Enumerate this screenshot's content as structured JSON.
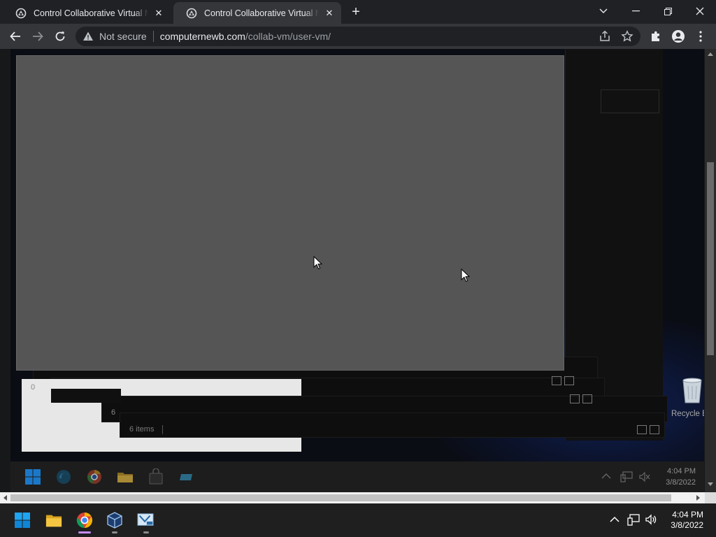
{
  "browser": {
    "tabs": [
      {
        "title": "Control Collaborative Virtual Machines",
        "active": false
      },
      {
        "title": "Control Collaborative Virtual Machines",
        "active": true
      }
    ],
    "new_tab_symbol": "+",
    "security_label": "Not secure",
    "url_host": "computernewb.com",
    "url_path": "/collab-vm/user-vm/"
  },
  "vm": {
    "explorer_status": "6 items",
    "partial_letter_1": "0",
    "partial_letter_2": "6",
    "recycle_label": "Recycle B",
    "clock_time": "4:04 PM",
    "clock_date": "3/8/2022"
  },
  "host_taskbar": {
    "clock_time": "4:04 PM",
    "clock_date": "3/8/2022",
    "pinned": [
      "start-icon",
      "file-explorer-icon",
      "chrome-icon",
      "virtualbox-icon",
      "vista-app-icon"
    ]
  },
  "colors": {
    "chrome_dark": "#202124",
    "chrome_toolbar": "#35363a",
    "vm_gray": "#555555",
    "win_blue": "#0078d4"
  }
}
